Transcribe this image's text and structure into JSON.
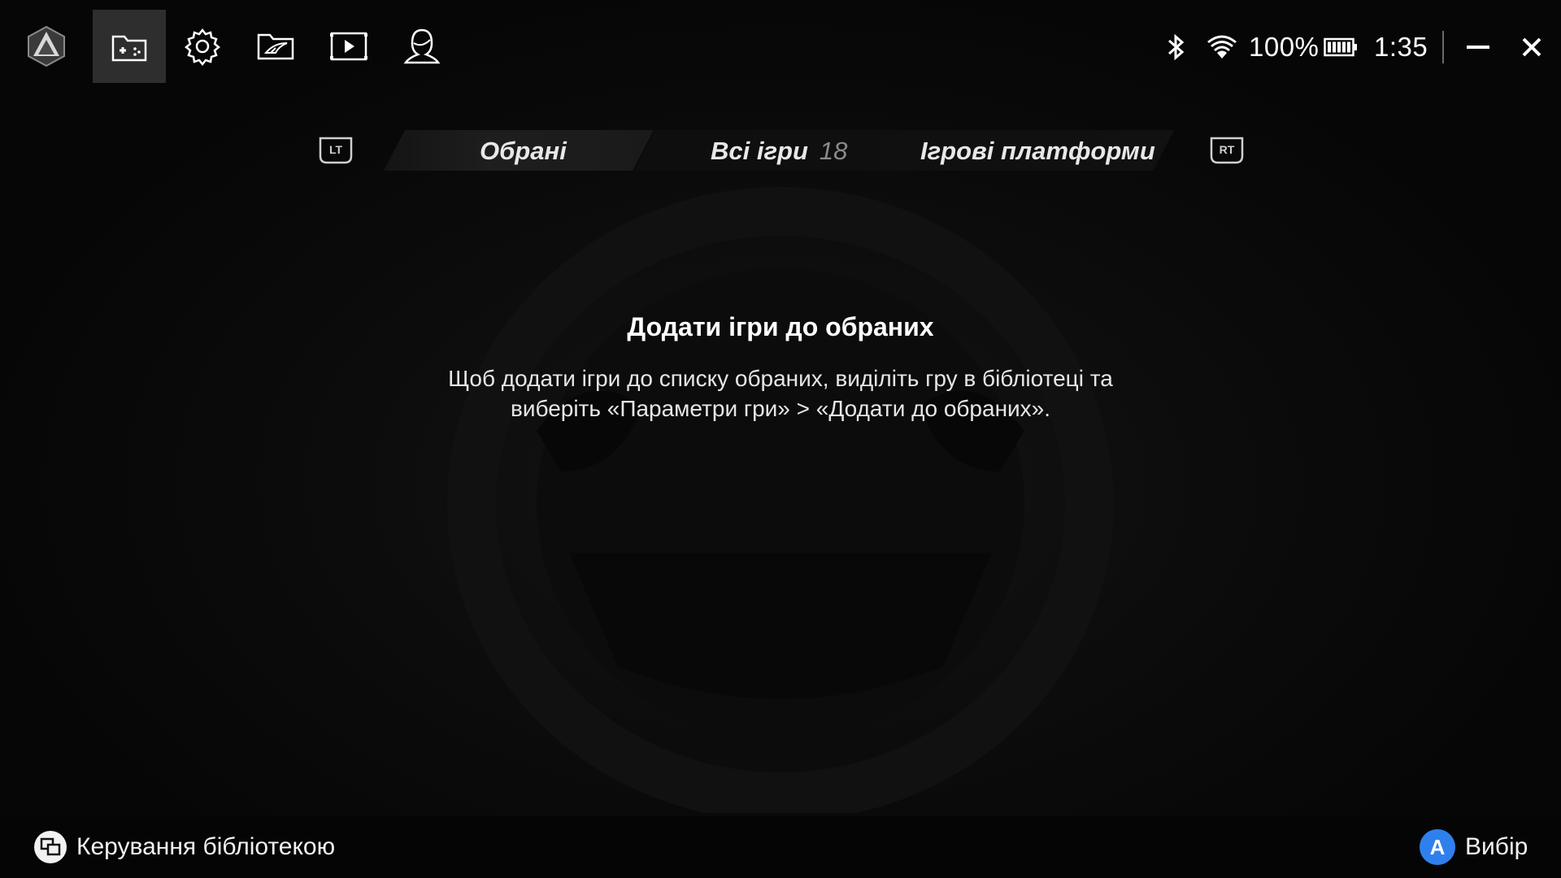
{
  "nav": {
    "items": [
      {
        "name": "armoury-logo-icon"
      },
      {
        "name": "game-library-icon",
        "active": true
      },
      {
        "name": "settings-gear-icon"
      },
      {
        "name": "rog-gallery-icon"
      },
      {
        "name": "media-player-icon"
      },
      {
        "name": "user-profile-icon"
      }
    ]
  },
  "status": {
    "bluetooth_icon": "bluetooth-icon",
    "wifi_icon": "wifi-icon",
    "battery_percent": "100%",
    "battery_icon": "battery-full-icon",
    "time": "1:35"
  },
  "window": {
    "minimize_icon": "minimize-icon",
    "close_icon": "close-icon"
  },
  "tabs": {
    "left_trigger": "LT",
    "right_trigger": "RT",
    "items": [
      {
        "label": "Обрані",
        "active": true
      },
      {
        "label": "Всі ігри",
        "count": "18"
      },
      {
        "label": "Ігрові платформи"
      }
    ]
  },
  "message": {
    "title": "Додати ігри до обраних",
    "line1": "Щоб додати ігри до списку обраних, виділіть гру в бібліотеці та",
    "line2": "виберіть «Параметри гри» > «Додати до обраних»."
  },
  "footer": {
    "manage_label": "Керування бібліотекою",
    "select_button": "A",
    "select_label": "Вибір"
  },
  "colors": {
    "background": "#060606",
    "active_nav": "#2e2e2e",
    "accent_blue": "#2f80ed"
  }
}
